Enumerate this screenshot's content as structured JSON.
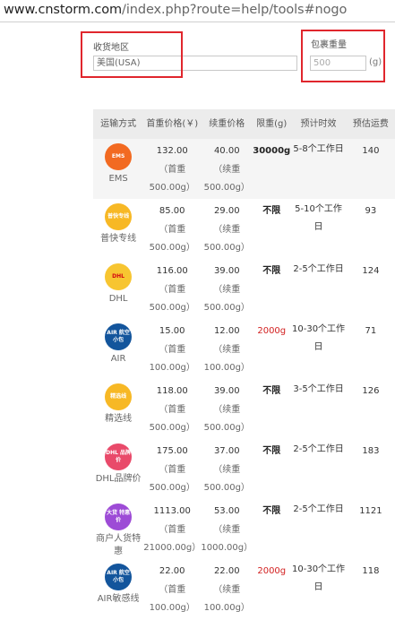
{
  "url": {
    "host": "www.cnstorm.com",
    "path": "/index.php?route=help/tools#nogo"
  },
  "form": {
    "region_label": "收货地区",
    "region_value": "美国(USA)",
    "weight_label": "包裹重量",
    "weight_placeholder": "500",
    "weight_unit": "(g)"
  },
  "table": {
    "headers": [
      "运输方式",
      "首重价格(￥)",
      "续重价格",
      "限重(g)",
      "预计时效",
      "预估运费"
    ],
    "rows": [
      {
        "icon": "EMS",
        "name": "EMS",
        "first": "132.00",
        "first_sub": "（首重500.00g）",
        "cont": "40.00",
        "cont_sub": "（续重500.00g）",
        "limit": "30000g",
        "time": "5-8个工作日",
        "fee": "140"
      },
      {
        "icon": "普快专线",
        "name": "普快专线",
        "first": "85.00",
        "first_sub": "（首重500.00g）",
        "cont": "29.00",
        "cont_sub": "（续重500.00g）",
        "limit": "不限",
        "time": "5-10个工作日",
        "fee": "93"
      },
      {
        "icon": "DHL",
        "name": "DHL",
        "first": "116.00",
        "first_sub": "（首重500.00g）",
        "cont": "39.00",
        "cont_sub": "（续重500.00g）",
        "limit": "不限",
        "time": "2-5个工作日",
        "fee": "124"
      },
      {
        "icon": "AIR 航空小包",
        "name": "AIR",
        "first": "15.00",
        "first_sub": "（首重100.00g）",
        "cont": "12.00",
        "cont_sub": "（续重100.00g）",
        "limit": "2000g",
        "time": "10-30个工作日",
        "fee": "71"
      },
      {
        "icon": "精选线",
        "name": "精选线",
        "first": "118.00",
        "first_sub": "（首重500.00g）",
        "cont": "39.00",
        "cont_sub": "（续重500.00g）",
        "limit": "不限",
        "time": "3-5个工作日",
        "fee": "126"
      },
      {
        "icon": "DHL 品牌价",
        "name": "DHL品牌价",
        "first": "175.00",
        "first_sub": "（首重500.00g）",
        "cont": "37.00",
        "cont_sub": "（续重500.00g）",
        "limit": "不限",
        "time": "2-5个工作日",
        "fee": "183"
      },
      {
        "icon": "大货 特惠价",
        "name": "商户人货特惠",
        "first": "1113.00",
        "first_sub": "（首重21000.00g）",
        "cont": "53.00",
        "cont_sub": "（续重1000.00g）",
        "limit": "不限",
        "time": "2-5个工作日",
        "fee": "1121"
      },
      {
        "icon": "AIR 航空小包",
        "name": "AIR敏感线",
        "first": "22.00",
        "first_sub": "（首重100.00g）",
        "cont": "22.00",
        "cont_sub": "（续重100.00g）",
        "limit": "2000g",
        "time": "10-30个工作日",
        "fee": "118"
      }
    ]
  },
  "colors": {
    "highlight_box": "#e0262d",
    "limit_red": "#d21f1f",
    "header_bg": "#ececec"
  }
}
